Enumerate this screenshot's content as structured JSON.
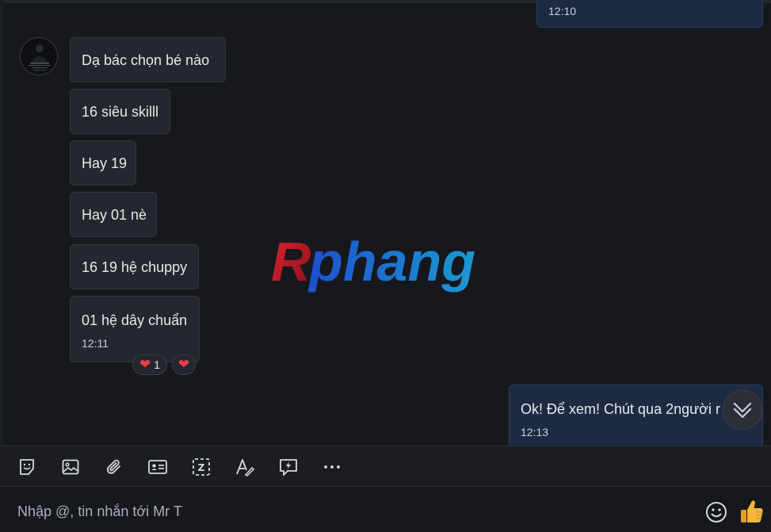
{
  "chat": {
    "prev_outgoing_time": "12:10",
    "incoming": [
      {
        "text": "Dạ bác chọn bé nào"
      },
      {
        "text": "16 siêu skilll"
      },
      {
        "text": "Hay 19"
      },
      {
        "text": "Hay 01 nè"
      },
      {
        "text": "16 19 hệ chuppy"
      },
      {
        "text": "01 hệ dây chuẩn",
        "time": "12:11"
      }
    ],
    "reactions": {
      "heart_count": "1",
      "heart_icon": "heart-icon"
    },
    "outgoing_last": {
      "text": "Ok! Để xem! Chút qua 2người r",
      "time": "12:13"
    },
    "watermark": "Rphang"
  },
  "toolbar": {
    "icons": [
      "sticker-icon",
      "image-icon",
      "attachment-icon",
      "contact-card-icon",
      "screenshot-icon",
      "text-format-icon",
      "quick-message-icon",
      "more-icon"
    ]
  },
  "composer": {
    "placeholder": "Nhập @, tin nhắn tới Mr T",
    "emoji_icon": "emoji-icon",
    "like_icon": "thumbs-up-icon"
  },
  "colors": {
    "background": "#16181d",
    "bubble_in": "#24272d",
    "bubble_out": "#1c2b42",
    "heart": "#ef3b4b",
    "like": "#f5b73a"
  }
}
